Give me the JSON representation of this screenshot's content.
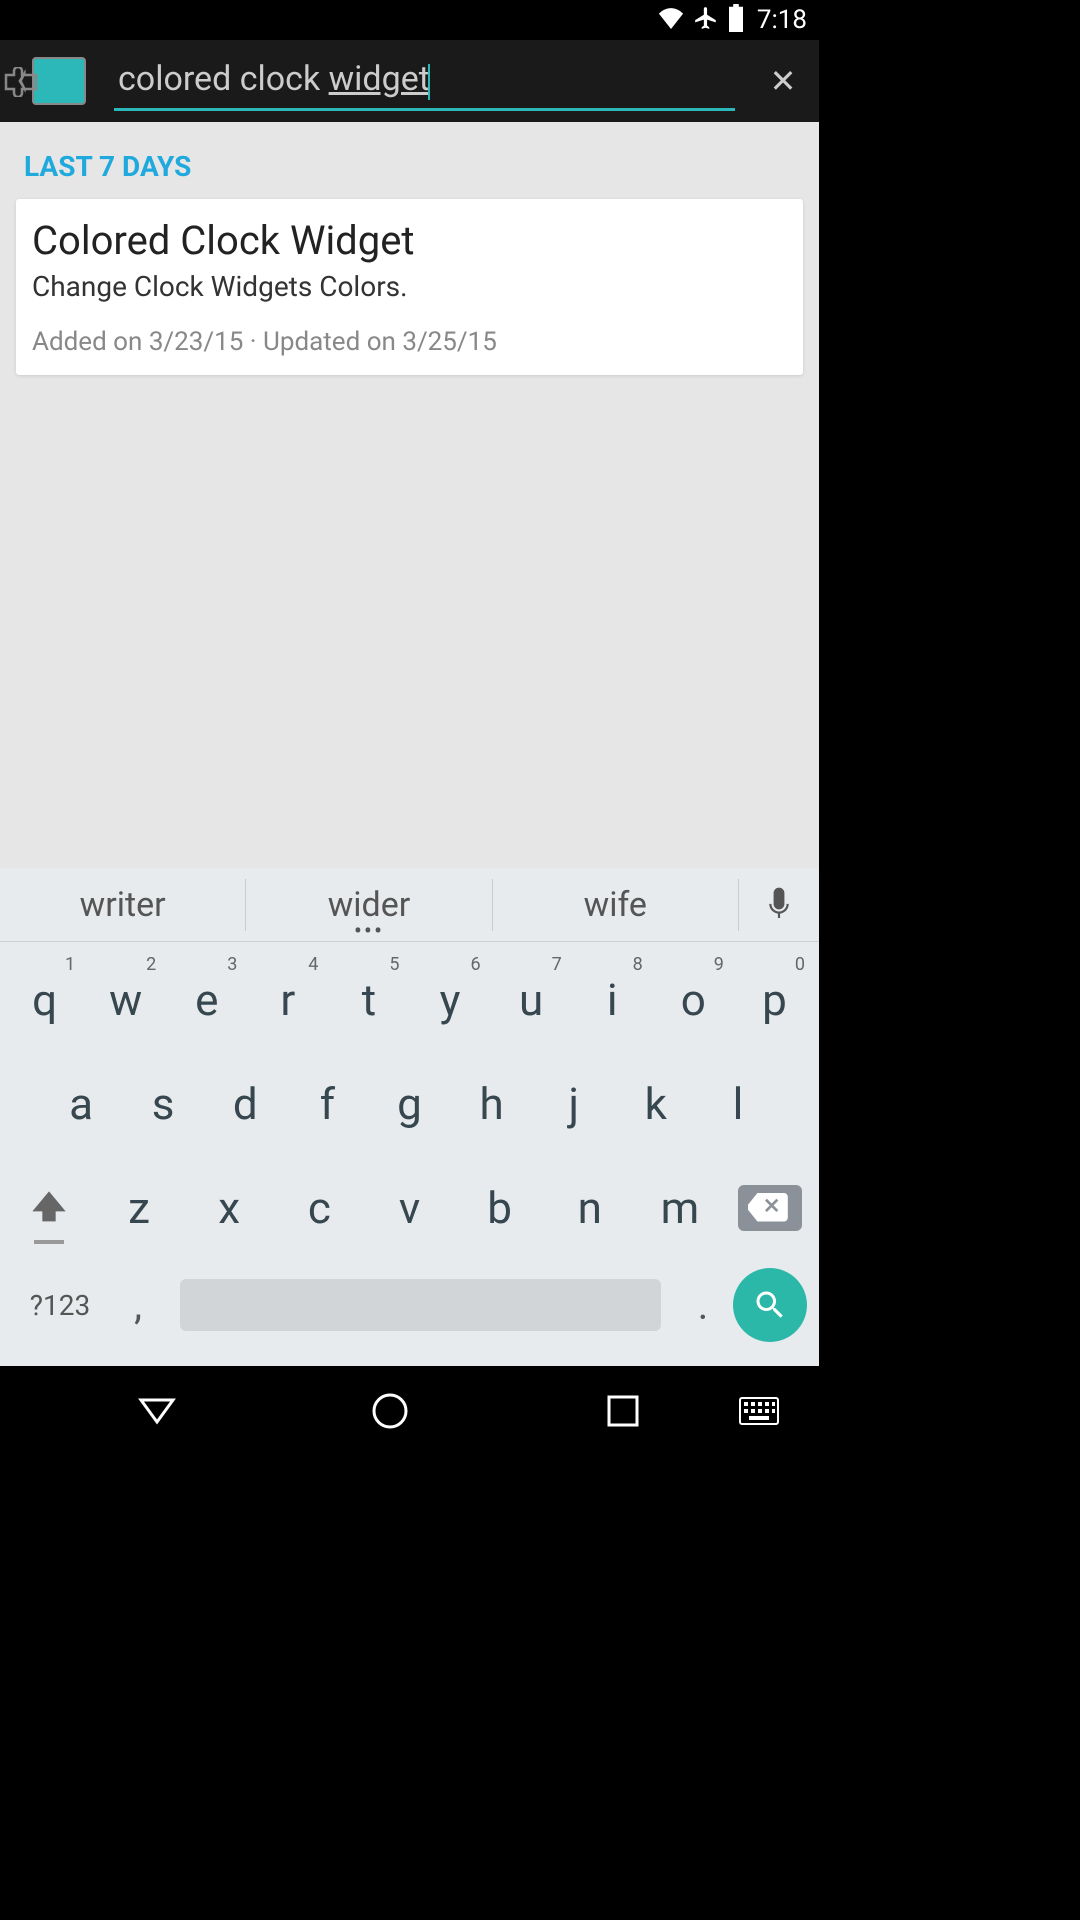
{
  "status": {
    "time": "7:18"
  },
  "search": {
    "value_prefix": "colored clock ",
    "value_underlined": "widget"
  },
  "results": {
    "section_header": "LAST 7 DAYS",
    "items": [
      {
        "title": "Colored Clock Widget",
        "desc": "Change Clock Widgets Colors.",
        "meta": "Added on 3/23/15 · Updated on 3/25/15"
      }
    ]
  },
  "keyboard": {
    "suggestions": [
      "writer",
      "wider",
      "wife"
    ],
    "row1": [
      {
        "k": "q",
        "n": "1"
      },
      {
        "k": "w",
        "n": "2"
      },
      {
        "k": "e",
        "n": "3"
      },
      {
        "k": "r",
        "n": "4"
      },
      {
        "k": "t",
        "n": "5"
      },
      {
        "k": "y",
        "n": "6"
      },
      {
        "k": "u",
        "n": "7"
      },
      {
        "k": "i",
        "n": "8"
      },
      {
        "k": "o",
        "n": "9"
      },
      {
        "k": "p",
        "n": "0"
      }
    ],
    "row2": [
      "a",
      "s",
      "d",
      "f",
      "g",
      "h",
      "j",
      "k",
      "l"
    ],
    "row3": [
      "z",
      "x",
      "c",
      "v",
      "b",
      "n",
      "m"
    ],
    "alt_label": "?123",
    "comma": ",",
    "period": "."
  }
}
